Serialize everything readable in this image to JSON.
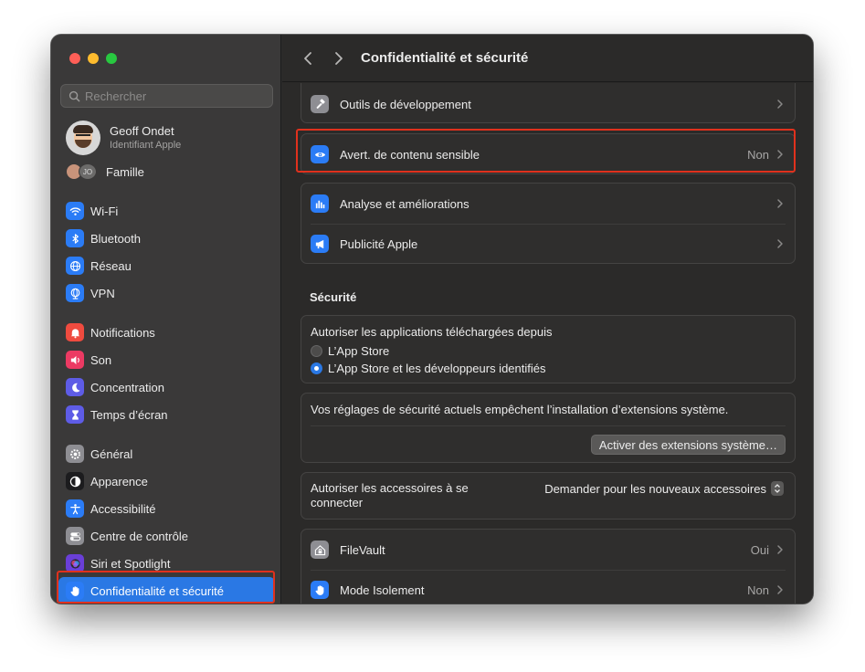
{
  "sidebar": {
    "search_placeholder": "Rechercher",
    "profile": {
      "name": "Geoff Ondet",
      "subtitle": "Identifiant Apple"
    },
    "family": {
      "label": "Famille",
      "avatar_initials": "JO"
    },
    "groups": [
      [
        {
          "label": "Wi-Fi",
          "icon": "wifi-icon",
          "color": "#2b7cf6"
        },
        {
          "label": "Bluetooth",
          "icon": "bluetooth-icon",
          "color": "#2b7cf6"
        },
        {
          "label": "Réseau",
          "icon": "globe-icon",
          "color": "#2b7cf6"
        },
        {
          "label": "VPN",
          "icon": "vpn-globe-icon",
          "color": "#2b7cf6"
        }
      ],
      [
        {
          "label": "Notifications",
          "icon": "bell-icon",
          "color": "#ef4b3f"
        },
        {
          "label": "Son",
          "icon": "speaker-icon",
          "color": "#ec3a63"
        },
        {
          "label": "Concentration",
          "icon": "moon-icon",
          "color": "#5e5ce6"
        },
        {
          "label": "Temps d’écran",
          "icon": "hourglass-icon",
          "color": "#5e5ce6"
        }
      ],
      [
        {
          "label": "Général",
          "icon": "gear-icon",
          "color": "#8e8e93"
        },
        {
          "label": "Apparence",
          "icon": "appearance-icon",
          "color": "#1c1c1e"
        },
        {
          "label": "Accessibilité",
          "icon": "accessibility-icon",
          "color": "#2b7cf6"
        },
        {
          "label": "Centre de contrôle",
          "icon": "toggles-icon",
          "color": "#8e8e93"
        },
        {
          "label": "Siri et Spotlight",
          "icon": "siri-icon",
          "color": "#6a3fd8"
        },
        {
          "label": "Confidentialité et sécurité",
          "icon": "hand-icon",
          "color": "#2b7cf6",
          "selected": true
        }
      ]
    ]
  },
  "main": {
    "title": "Confidentialité et sécurité",
    "rows_top": [
      {
        "label": "Outils de développement",
        "value": "",
        "icon": "hammer-icon",
        "color": "#8e8e93"
      }
    ],
    "sensitive": {
      "label": "Avert. de contenu sensible",
      "value": "Non",
      "icon": "eye-icon",
      "color": "#2b7cf6"
    },
    "rows_analytics": [
      {
        "label": "Analyse et améliorations",
        "value": "",
        "icon": "bar-chart-icon",
        "color": "#2b7cf6"
      },
      {
        "label": "Publicité Apple",
        "value": "",
        "icon": "megaphone-icon",
        "color": "#2b7cf6"
      }
    ],
    "security": {
      "title": "Sécurité",
      "allow_label": "Autoriser les applications téléchargées depuis",
      "option_app_store": "L’App Store",
      "option_identified": "L’App Store et les développeurs identifiés",
      "extensions_text": "Vos réglages de sécurité actuels empêchent l’installation d’extensions système.",
      "extensions_button": "Activer des extensions système…",
      "accessories_label": "Autoriser les accessoires à se connecter",
      "accessories_value": "Demander pour les nouveaux accessoires"
    },
    "rows_bottom": [
      {
        "label": "FileVault",
        "value": "Oui",
        "icon": "house-lock-icon",
        "color": "#8e8e93"
      },
      {
        "label": "Mode Isolement",
        "value": "Non",
        "icon": "hand-icon",
        "color": "#2b7cf6"
      }
    ]
  }
}
